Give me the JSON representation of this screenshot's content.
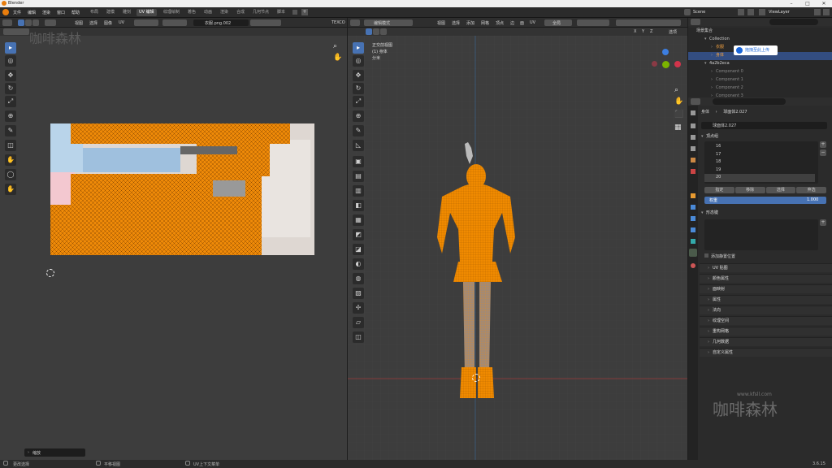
{
  "app": {
    "title": "Blender",
    "version": "3.6.15"
  },
  "menu": [
    "文件",
    "编辑",
    "渲染",
    "窗口",
    "帮助"
  ],
  "workspaces": [
    "布局",
    "建模",
    "雕刻",
    "UV 编辑",
    "纹理绘制",
    "着色",
    "动画",
    "渲染",
    "合成",
    "几何节点",
    "脚本"
  ],
  "workspace_active": "UV 编辑",
  "scene": {
    "name": "Scene",
    "view_layer": "ViewLayer"
  },
  "uv_editor": {
    "menu": [
      "视图",
      "选择",
      "图像",
      "UV"
    ],
    "image_name": "衣服.png.002",
    "texcoord": "TEXCO",
    "tool_label": "缩放"
  },
  "viewport": {
    "mode": "编辑模式",
    "menu": [
      "视图",
      "选择",
      "添加",
      "网格",
      "顶点",
      "边",
      "面",
      "UV"
    ],
    "transform": "全局",
    "options": "选项",
    "info": [
      "正交前视图",
      "(1) 身体",
      "分米"
    ],
    "axes": [
      "X",
      "Y",
      "Z"
    ]
  },
  "outliner": {
    "title": "场景集合",
    "upload_badge": "拖拽至此上传",
    "rows": [
      {
        "name": "Collection",
        "indent": 1
      },
      {
        "name": "衣服",
        "indent": 2
      },
      {
        "name": "身体",
        "indent": 2,
        "selected": true
      },
      {
        "name": "4a2b2eca",
        "indent": 1
      },
      {
        "name": "Component 0",
        "indent": 2
      },
      {
        "name": "Component 1",
        "indent": 2
      },
      {
        "name": "Component 2",
        "indent": 2
      },
      {
        "name": "Component 3",
        "indent": 2
      }
    ]
  },
  "properties": {
    "breadcrumb_obj": "身体",
    "breadcrumb_mesh": "球面体2.027",
    "mesh_name": "球面体2.027",
    "vertex_groups_title": "顶点组",
    "vertex_groups": [
      "16",
      "17",
      "18",
      "19",
      "20"
    ],
    "buttons": [
      "指定",
      "移除",
      "选择",
      "弃选"
    ],
    "weight_label": "权重",
    "weight_value": "1.000",
    "shape_keys_title": "形态键",
    "add_rest_position": "添加静置位置",
    "sections": [
      "UV 贴图",
      "颜色属性",
      "面映射",
      "属性",
      "法向",
      "纹理空间",
      "重构网格",
      "几何数据",
      "自定义属性"
    ]
  },
  "status": [
    "更改选择",
    "平移视图",
    "UV上下文菜单"
  ],
  "watermark_text": "咖啡森林",
  "watermark_url": "www.kfsll.com",
  "accent": "#4772b3",
  "orange": "#f08a00"
}
